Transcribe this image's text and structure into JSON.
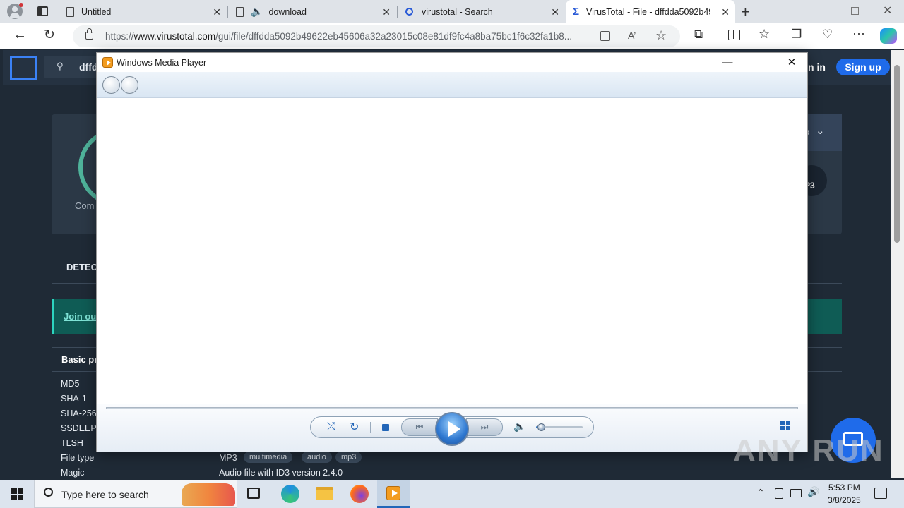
{
  "browser": {
    "tabs": [
      {
        "title": "Untitled",
        "icon": "document-icon"
      },
      {
        "title": "download",
        "icon": "document-icon"
      },
      {
        "title": "virustotal - Search",
        "icon": "search-icon"
      },
      {
        "title": "VirusTotal - File - dffdda5092b49",
        "icon": "virustotal-icon",
        "active": true
      }
    ],
    "url_prefix": "https://",
    "url_domain": "www.virustotal.com",
    "url_path": "/gui/file/dffdda5092b49622eb45606a32a23015c08e81df9fc4a8ba75bc1f6c32fa1b8..."
  },
  "vt": {
    "search_value": "dffd",
    "signin": "n in",
    "signup": "Sign up",
    "community": "Com",
    "dropdown_partial": "e",
    "mp3_badge": "P3",
    "tab_detection": "DETEC",
    "join_banner": "Join ou",
    "basic_props": "Basic pr",
    "props": [
      {
        "key": "MD5"
      },
      {
        "key": "SHA-1"
      },
      {
        "key": "SHA-256"
      },
      {
        "key": "SSDEEP"
      },
      {
        "key": "TLSH"
      },
      {
        "key": "File type",
        "value": "MP3",
        "tags": [
          "multimedia",
          "audio",
          "mp3"
        ]
      },
      {
        "key": "Magic",
        "value": "Audio file with ID3 version 2.4.0"
      }
    ]
  },
  "wmp": {
    "title": "Windows Media Player",
    "volume_percent": 10
  },
  "taskbar": {
    "search_placeholder": "Type here to search",
    "time": "5:53 PM",
    "date": "3/8/2025"
  },
  "watermark": "ANY RUN"
}
